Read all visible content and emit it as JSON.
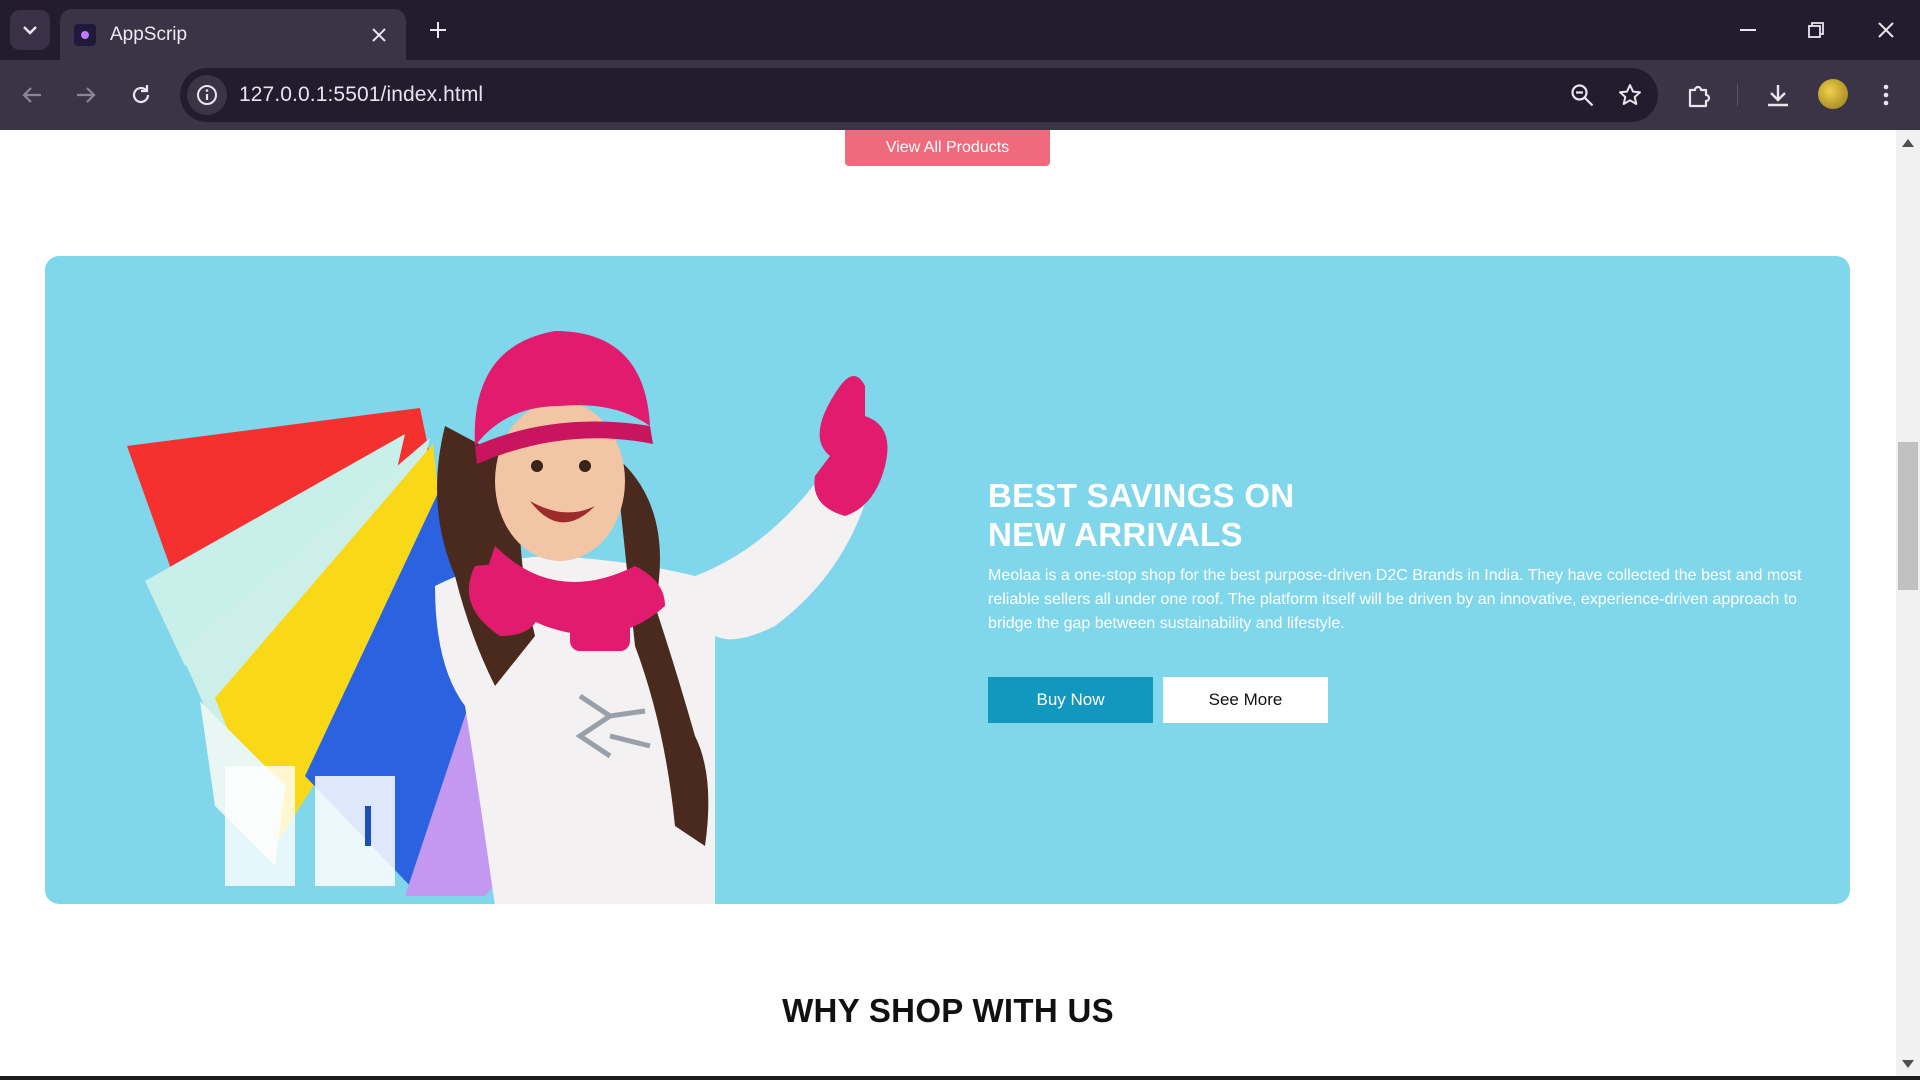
{
  "browser": {
    "tab_title": "AppScrip",
    "url": "127.0.0.1:5501/index.html",
    "icons": [
      "tab-list-icon",
      "close-icon",
      "plus-icon",
      "minimize-icon",
      "restore-icon",
      "close-window-icon",
      "back-arrow-icon",
      "forward-arrow-icon",
      "reload-icon",
      "info-icon",
      "zoom-icon",
      "star-icon",
      "extensions-icon",
      "download-icon",
      "menu-dots-icon"
    ]
  },
  "page": {
    "view_all_label": "View All Products",
    "promo": {
      "title": "BEST SAVINGS ON\nNEW ARRIVALS",
      "description": "Meolaa is a one-stop shop for the best purpose-driven D2C Brands in India. They have collected the best and most reliable sellers all under one roof. The platform itself will be driven by an innovative, experience-driven approach to bridge the gap between sustainability and lifestyle.",
      "buy_label": "Buy Now",
      "more_label": "See More",
      "background_color": "#80d6ea",
      "buy_color": "#1298bf"
    },
    "why_title": "WHY SHOP WITH US",
    "accent_color": "#ee6a7c"
  }
}
